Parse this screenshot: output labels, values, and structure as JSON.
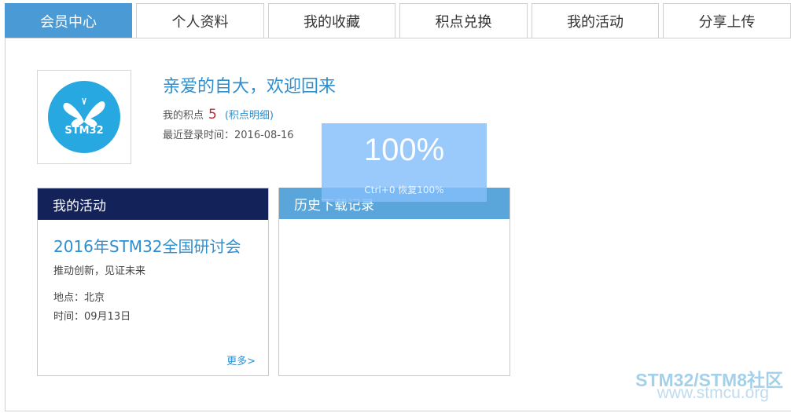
{
  "tabs": [
    {
      "label": "会员中心",
      "active": true
    },
    {
      "label": "个人资料",
      "active": false
    },
    {
      "label": "我的收藏",
      "active": false
    },
    {
      "label": "积点兑换",
      "active": false
    },
    {
      "label": "我的活动",
      "active": false
    },
    {
      "label": "分享上传",
      "active": false
    }
  ],
  "profile": {
    "avatar_text": "STM32",
    "welcome": "亲爱的自大，欢迎回来",
    "points_label": "我的积点",
    "points_value": "5",
    "points_link": "(积点明细)",
    "last_login": "最近登录时间：2016-08-16"
  },
  "zoom": {
    "percent": "100%",
    "hint": "Ctrl+0 恢复100%"
  },
  "activity_panel": {
    "title": "我的活动",
    "event_title": "2016年STM32全国研讨会",
    "event_subtitle": "推动创新，见证未来",
    "place": "地点：北京",
    "time": "时间：09月13日",
    "more": "更多>"
  },
  "history_panel": {
    "title": "历史下载记录"
  },
  "watermark": {
    "line1": "STM32/STM8社区",
    "line2": "www.stmcu.org"
  },
  "colors": {
    "tab_active": "#4a9bd5",
    "accent_blue": "#2d8fcf",
    "points_red": "#c0262d",
    "activity_header": "#14225a",
    "history_header": "#5aa6da",
    "logo_blue": "#28a8e0"
  }
}
